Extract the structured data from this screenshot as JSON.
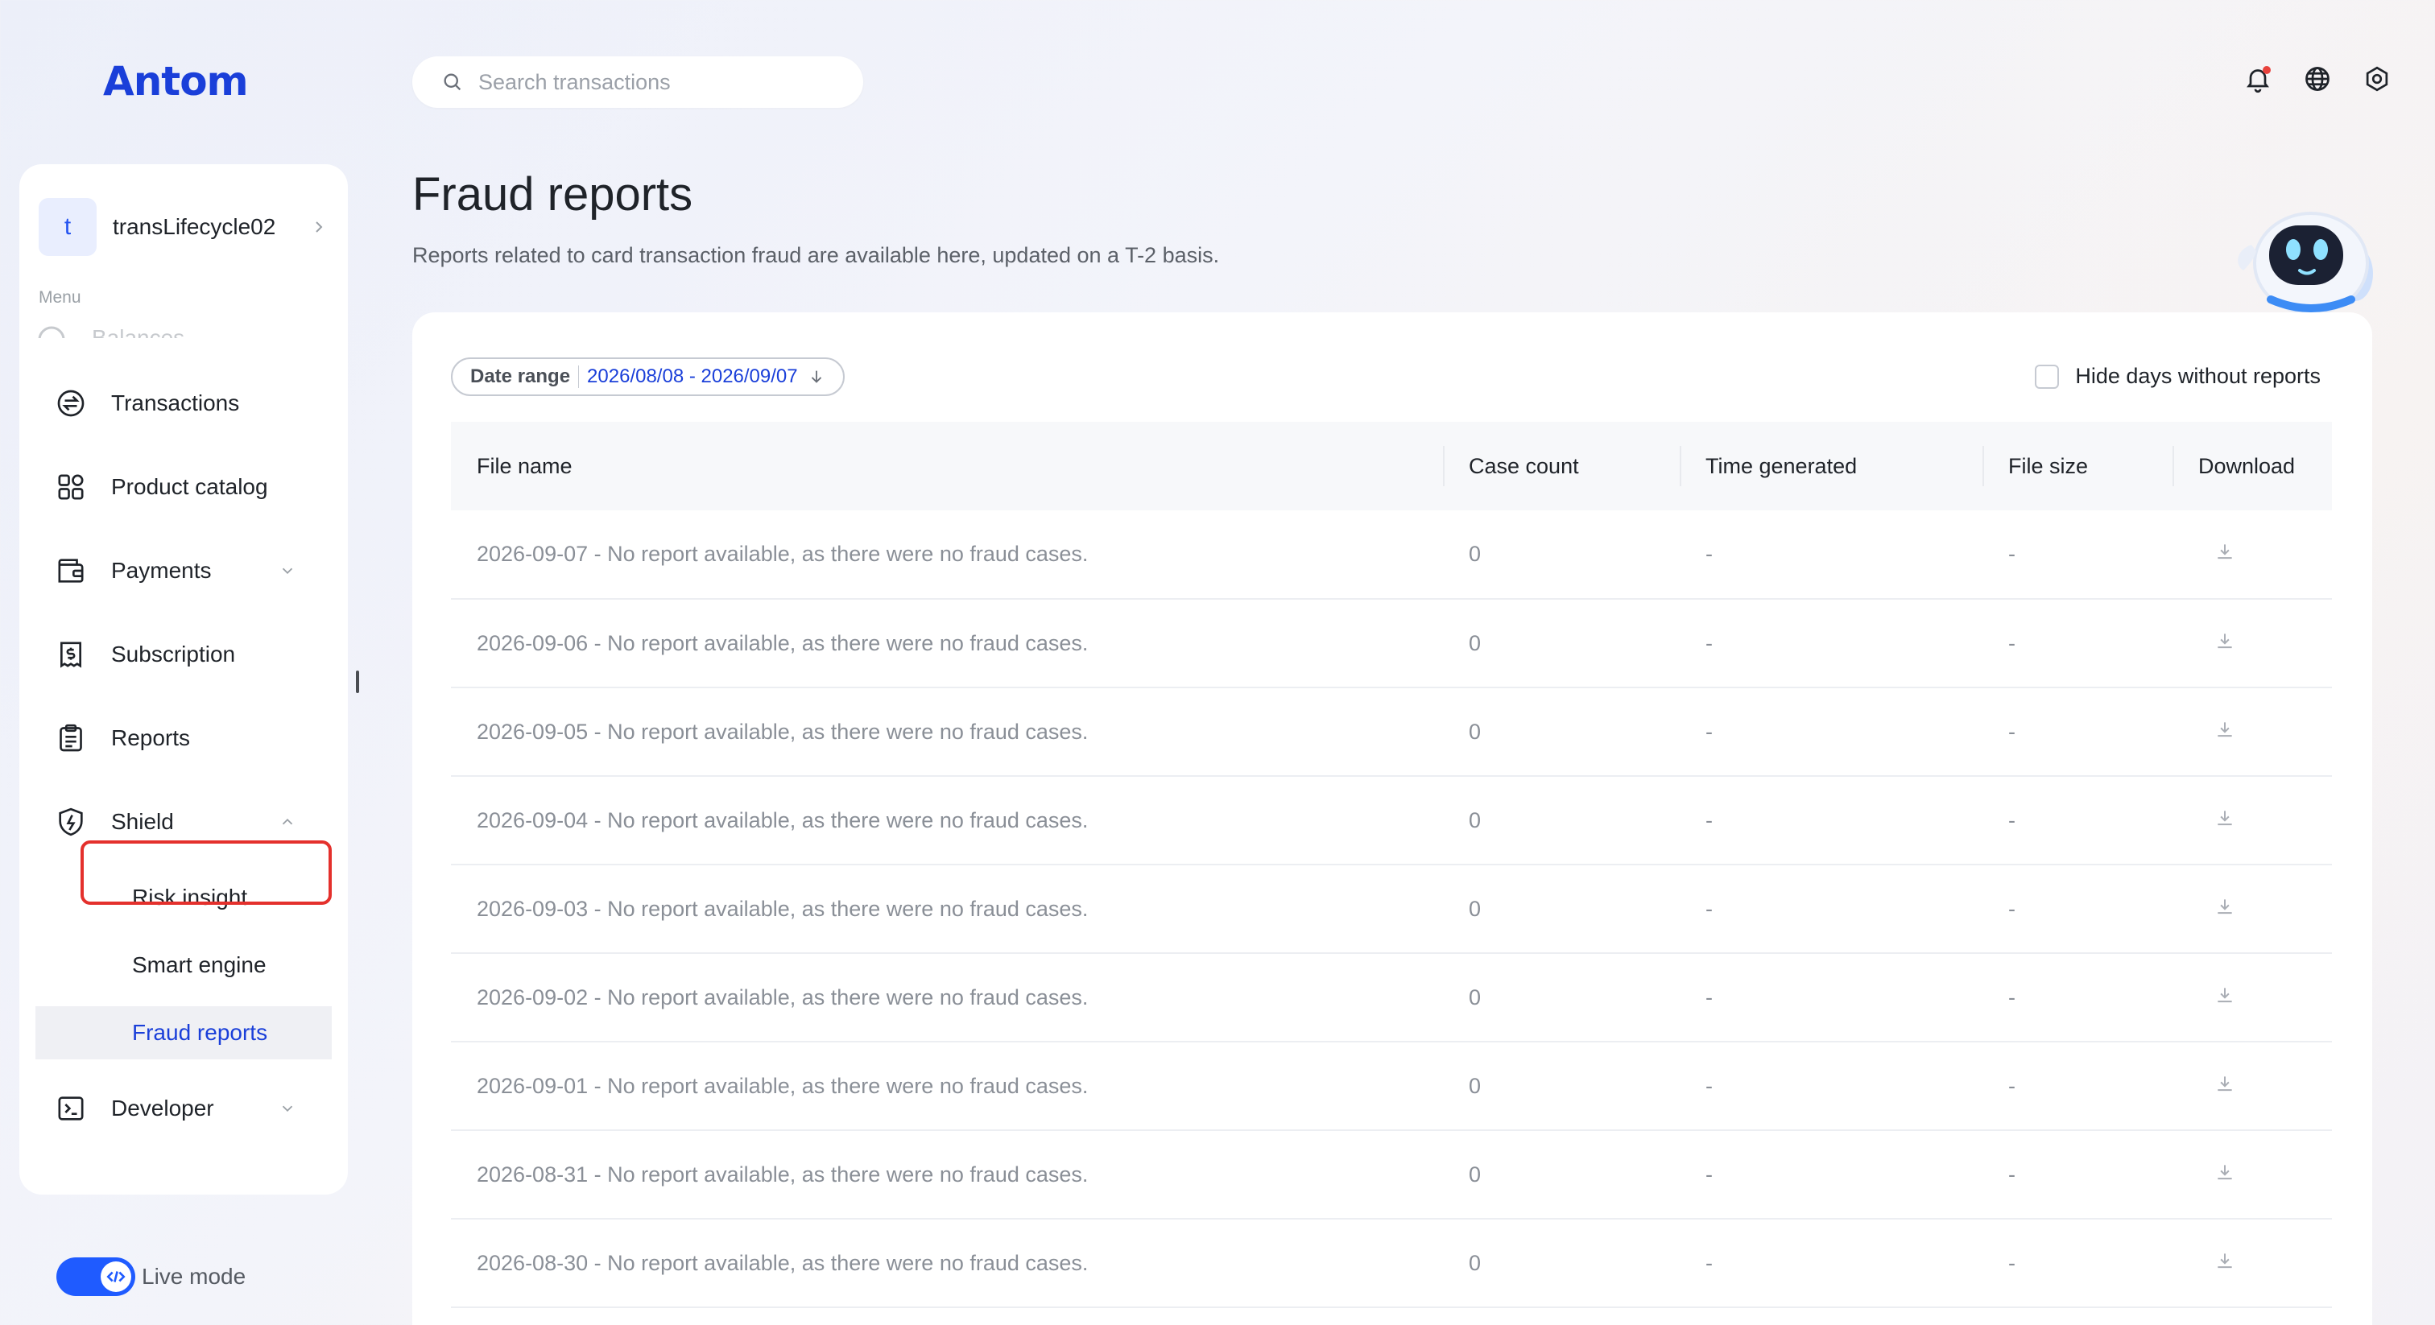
{
  "logo": "Antom",
  "search": {
    "placeholder": "Search transactions"
  },
  "account": {
    "initial": "t",
    "name": "transLifecycle02"
  },
  "sidebar": {
    "menu_label": "Menu",
    "faded_item": "Balances",
    "items": [
      {
        "label": "Transactions",
        "icon": "transfer-icon"
      },
      {
        "label": "Product catalog",
        "icon": "grid-icon"
      },
      {
        "label": "Payments",
        "icon": "wallet-icon"
      },
      {
        "label": "Subscription",
        "icon": "receipt-icon"
      },
      {
        "label": "Reports",
        "icon": "clipboard-icon"
      },
      {
        "label": "Shield",
        "icon": "shield-icon"
      },
      {
        "label": "Developer",
        "icon": "terminal-icon"
      }
    ],
    "shield_sub": [
      {
        "label": "Risk insight"
      },
      {
        "label": "Smart engine"
      },
      {
        "label": "Fraud reports"
      }
    ]
  },
  "live_mode": {
    "label": "Live mode"
  },
  "page": {
    "title": "Fraud reports",
    "subtitle": "Reports related to card transaction fraud are available here, updated on a T-2 basis."
  },
  "filters": {
    "date_range_label": "Date range",
    "date_range_value": "2026/08/08 - 2026/09/07",
    "hide_days_label": "Hide days without reports"
  },
  "table": {
    "columns": [
      "File name",
      "Case count",
      "Time generated",
      "File size",
      "Download"
    ],
    "rows": [
      {
        "file": "2026-09-07 - No report available, as there were no fraud cases.",
        "count": "0",
        "time": "-",
        "size": "-"
      },
      {
        "file": "2026-09-06 - No report available, as there were no fraud cases.",
        "count": "0",
        "time": "-",
        "size": "-"
      },
      {
        "file": "2026-09-05 - No report available, as there were no fraud cases.",
        "count": "0",
        "time": "-",
        "size": "-"
      },
      {
        "file": "2026-09-04 - No report available, as there were no fraud cases.",
        "count": "0",
        "time": "-",
        "size": "-"
      },
      {
        "file": "2026-09-03 - No report available, as there were no fraud cases.",
        "count": "0",
        "time": "-",
        "size": "-"
      },
      {
        "file": "2026-09-02 - No report available, as there were no fraud cases.",
        "count": "0",
        "time": "-",
        "size": "-"
      },
      {
        "file": "2026-09-01 - No report available, as there were no fraud cases.",
        "count": "0",
        "time": "-",
        "size": "-"
      },
      {
        "file": "2026-08-31 - No report available, as there were no fraud cases.",
        "count": "0",
        "time": "-",
        "size": "-"
      },
      {
        "file": "2026-08-30 - No report available, as there were no fraud cases.",
        "count": "0",
        "time": "-",
        "size": "-"
      }
    ]
  },
  "colors": {
    "accent": "#1a3fd9",
    "highlight": "#e4302c",
    "toggle": "#1f5bff"
  }
}
